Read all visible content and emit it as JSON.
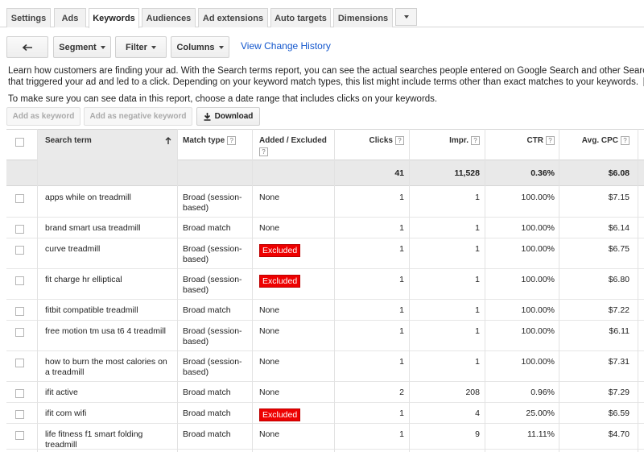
{
  "tabs": [
    {
      "label": "Settings",
      "active": false
    },
    {
      "label": "Ads",
      "active": false
    },
    {
      "label": "Keywords",
      "active": true
    },
    {
      "label": "Audiences",
      "active": false
    },
    {
      "label": "Ad extensions",
      "active": false
    },
    {
      "label": "Auto targets",
      "active": false
    },
    {
      "label": "Dimensions",
      "active": false
    }
  ],
  "toolbar": {
    "back_icon": "back-arrow-icon",
    "segment": "Segment",
    "filter": "Filter",
    "columns": "Columns",
    "history_link": "View Change History"
  },
  "description": {
    "line1": "Learn how customers are finding your ad. With the Search terms report, you can see the actual searches people entered on Google Search and other Search N",
    "line2": "that triggered your ad and led to a click. Depending on your keyword match types, this list might include terms other than exact matches to your keywords.",
    "help": "?",
    "note": "To make sure you can see data in this report, choose a date range that includes clicks on your keywords."
  },
  "actions": {
    "add_keyword": "Add as keyword",
    "add_negative": "Add as negative keyword",
    "download": "Download"
  },
  "table": {
    "headers": {
      "search_term": "Search term",
      "match_type": "Match type",
      "added_excluded": "Added / Excluded",
      "clicks": "Clicks",
      "impr": "Impr.",
      "ctr": "CTR",
      "avg_cpc": "Avg. CPC",
      "help": "?"
    },
    "totals": {
      "clicks": "41",
      "impr": "11,528",
      "ctr": "0.36%",
      "avg_cpc": "$6.08"
    },
    "rows": [
      {
        "term": "apps while on treadmill",
        "match": "Broad (session-based)",
        "status": "None",
        "clicks": "1",
        "impr": "1",
        "ctr": "100.00%",
        "cpc": "$7.15"
      },
      {
        "term": "brand smart usa treadmill",
        "match": "Broad match",
        "status": "None",
        "clicks": "1",
        "impr": "1",
        "ctr": "100.00%",
        "cpc": "$6.14"
      },
      {
        "term": "curve treadmill",
        "match": "Broad (session-based)",
        "status": "Excluded",
        "clicks": "1",
        "impr": "1",
        "ctr": "100.00%",
        "cpc": "$6.75"
      },
      {
        "term": "fit charge hr elliptical",
        "match": "Broad (session-based)",
        "status": "Excluded",
        "clicks": "1",
        "impr": "1",
        "ctr": "100.00%",
        "cpc": "$6.80"
      },
      {
        "term": "fitbit compatible treadmill",
        "match": "Broad match",
        "status": "None",
        "clicks": "1",
        "impr": "1",
        "ctr": "100.00%",
        "cpc": "$7.22"
      },
      {
        "term": "free motion tm usa t6 4 treadmill",
        "match": "Broad (session-based)",
        "status": "None",
        "clicks": "1",
        "impr": "1",
        "ctr": "100.00%",
        "cpc": "$6.11"
      },
      {
        "term": "how to burn the most calories on a treadmill",
        "match": "Broad (session-based)",
        "status": "None",
        "clicks": "1",
        "impr": "1",
        "ctr": "100.00%",
        "cpc": "$7.31"
      },
      {
        "term": "ifit active",
        "match": "Broad match",
        "status": "None",
        "clicks": "2",
        "impr": "208",
        "ctr": "0.96%",
        "cpc": "$7.29"
      },
      {
        "term": "ifit com wifi",
        "match": "Broad match",
        "status": "Excluded",
        "clicks": "1",
        "impr": "4",
        "ctr": "25.00%",
        "cpc": "$6.59"
      },
      {
        "term": "life fitness f1 smart folding treadmill",
        "match": "Broad match",
        "status": "None",
        "clicks": "1",
        "impr": "9",
        "ctr": "11.11%",
        "cpc": "$4.70"
      }
    ]
  }
}
